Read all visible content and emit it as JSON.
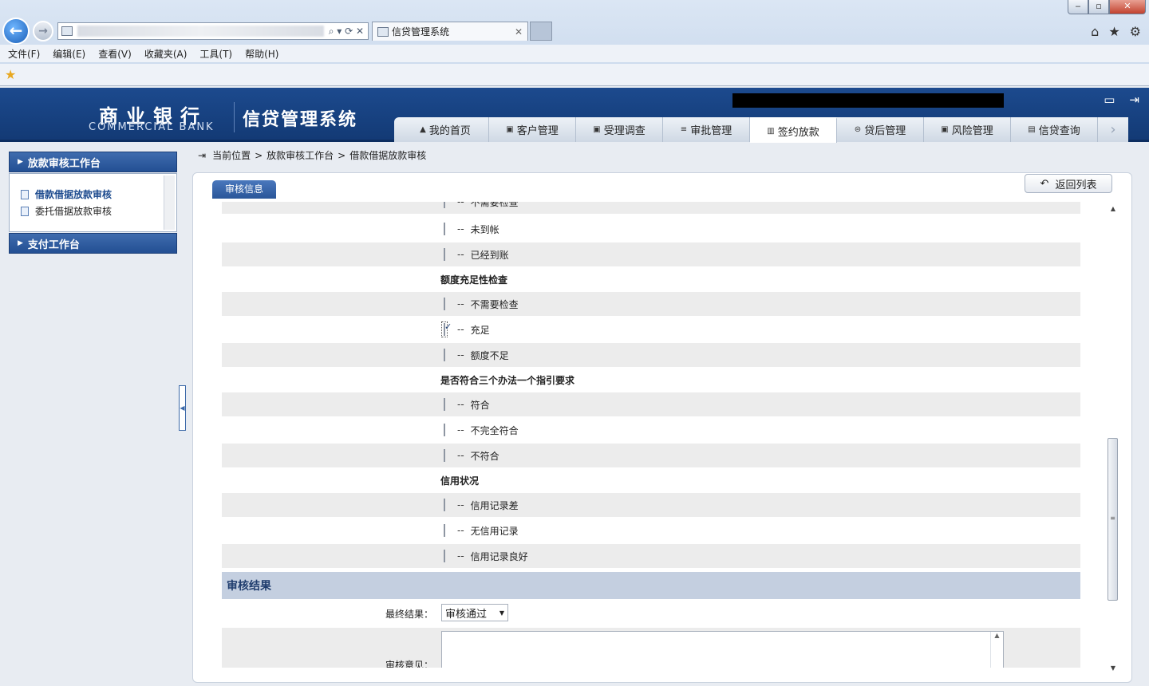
{
  "browser": {
    "tab_title": "信贷管理系统",
    "menu": [
      "文件(F)",
      "编辑(E)",
      "查看(V)",
      "收藏夹(A)",
      "工具(T)",
      "帮助(H)"
    ],
    "window_controls": {
      "minimize": "‒",
      "maximize": "▫",
      "close": "✕"
    },
    "address_controls": "⌕ ▾ ⟳ ✕",
    "right_icons": {
      "home": "⌂",
      "star": "★",
      "gear": "⚙"
    }
  },
  "app": {
    "logo_cn": "商业银行",
    "logo_en": "COMMERCIAL BANK",
    "system_title": "信贷管理系统",
    "nav": [
      {
        "icon": "▲",
        "label": "我的首页",
        "active": false
      },
      {
        "icon": "▣",
        "label": "客户管理",
        "active": false
      },
      {
        "icon": "▣",
        "label": "受理调查",
        "active": false
      },
      {
        "icon": "≡",
        "label": "审批管理",
        "active": false
      },
      {
        "icon": "▥",
        "label": "签约放款",
        "active": true
      },
      {
        "icon": "⊜",
        "label": "贷后管理",
        "active": false
      },
      {
        "icon": "▣",
        "label": "风险管理",
        "active": false
      },
      {
        "icon": "▤",
        "label": "信贷查询",
        "active": false
      }
    ],
    "nav_more": "›"
  },
  "sidebar": {
    "group1": "放款审核工作台",
    "items": [
      "借款借据放款审核",
      "委托借据放款审核"
    ],
    "group2": "支付工作台"
  },
  "breadcrumb": {
    "icon": "⇥",
    "parts": [
      "当前位置",
      ">",
      "放款审核工作台",
      ">",
      "借款借据放款审核"
    ]
  },
  "panel": {
    "tab_label": "审核信息",
    "return_button": "返回列表",
    "return_icon": "↶"
  },
  "form": {
    "dash": "--",
    "partial_top": "不需要检查",
    "funds_rows": [
      "未到帐",
      "已经到账"
    ],
    "section_amount": "额度充足性检查",
    "amount_rows": [
      "不需要检查",
      "充足",
      "额度不足"
    ],
    "section_compliance": "是否符合三个办法一个指引要求",
    "compliance_rows": [
      "符合",
      "不完全符合",
      "不符合"
    ],
    "section_credit": "信用状况",
    "credit_rows": [
      "信用记录差",
      "无信用记录",
      "信用记录良好"
    ],
    "checked": "充足",
    "result_header": "审核结果",
    "final_result_label": "最终结果：",
    "final_result_value": "审核通过",
    "opinion_label": "审核意见："
  }
}
